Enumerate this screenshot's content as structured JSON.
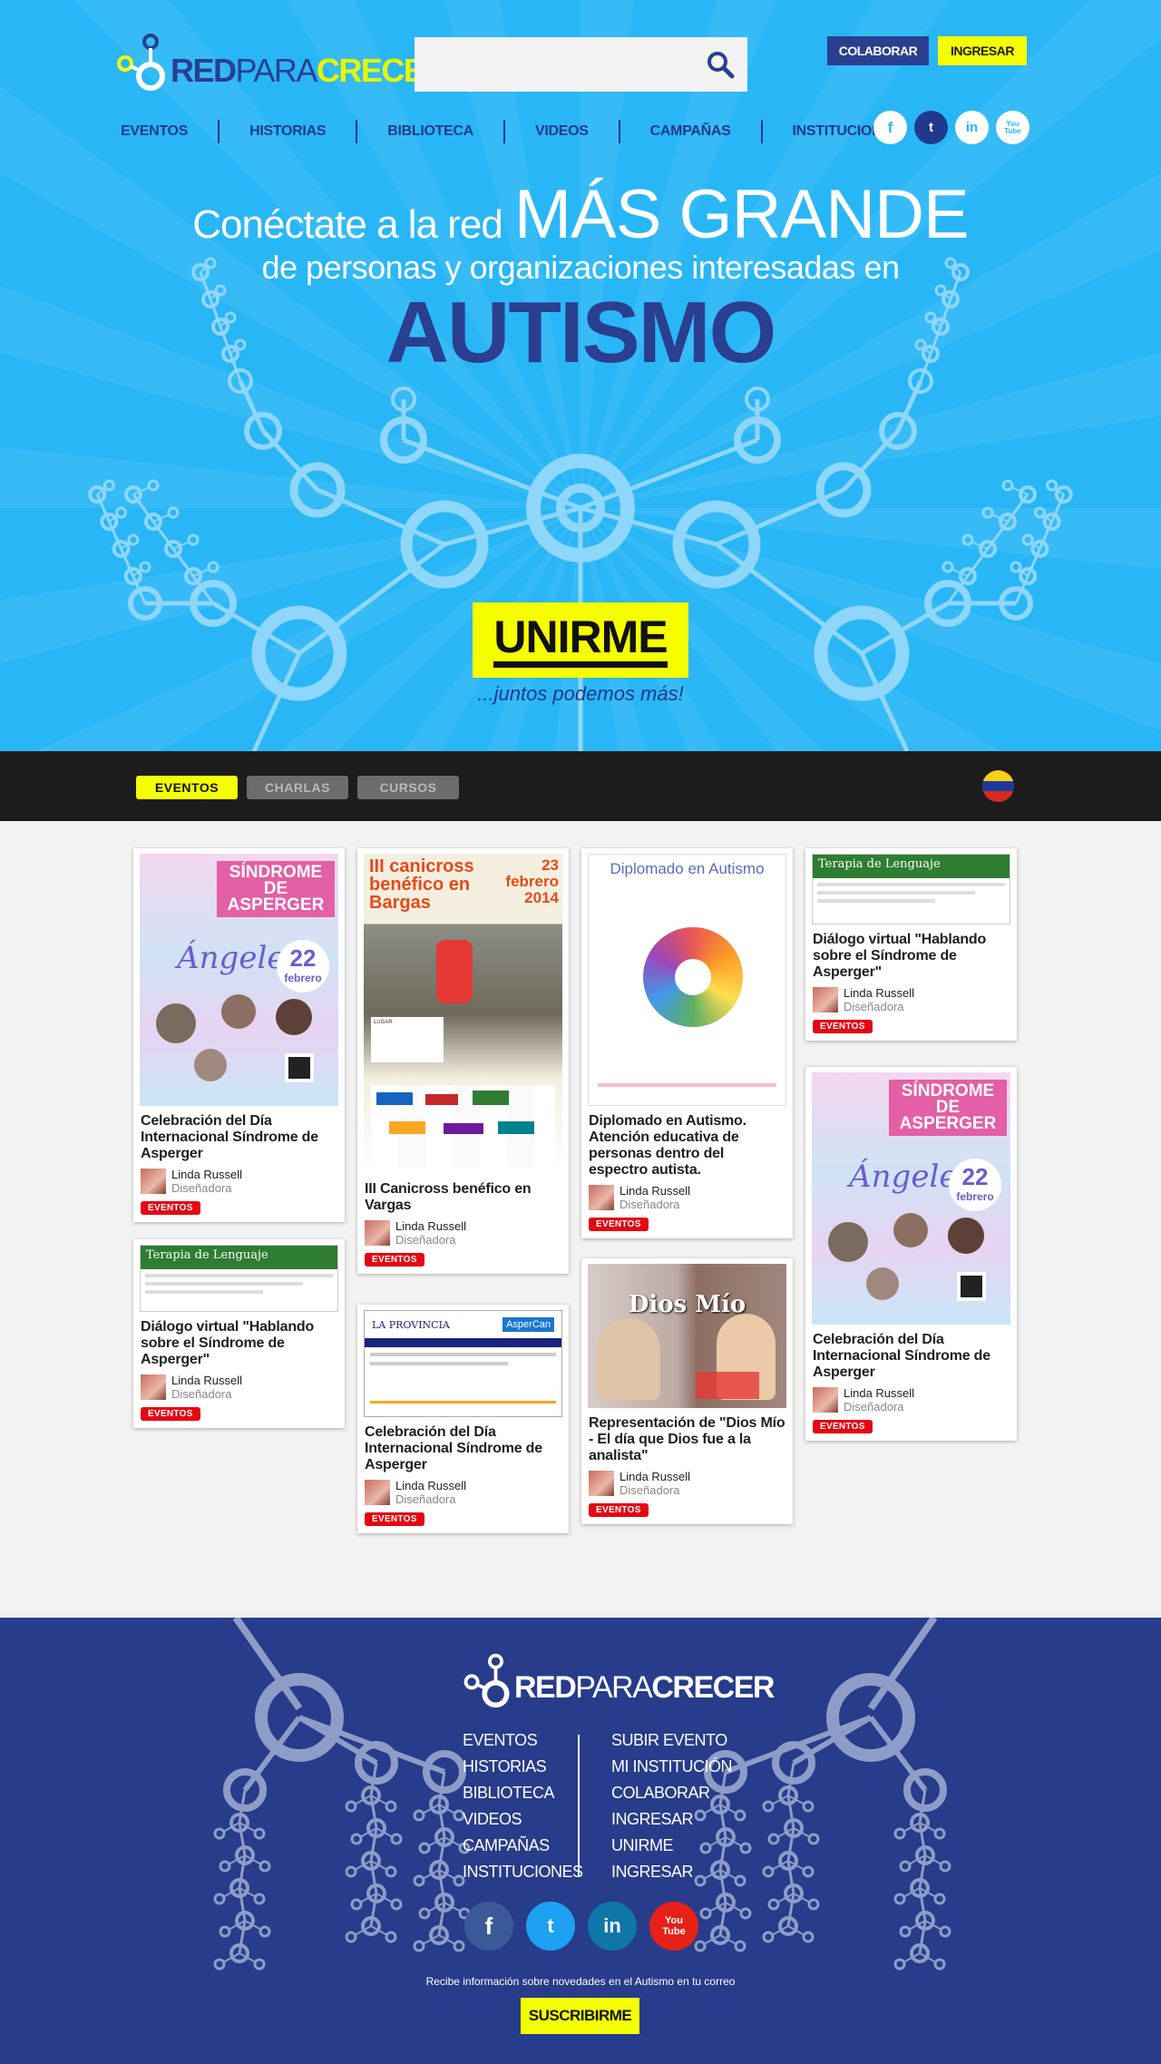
{
  "header": {
    "logo": {
      "part1": "RED",
      "part2": "PARA",
      "part3": "CRECER"
    },
    "search": {
      "placeholder": "",
      "icon": "search-icon"
    },
    "buttons": {
      "colaborar": "COLABORAR",
      "ingresar": "INGRESAR"
    },
    "nav": [
      "EVENTOS",
      "HISTORIAS",
      "BIBLIOTECA",
      "VIDEOS",
      "CAMPAÑAS",
      "INSTITUCIONES"
    ],
    "social": [
      {
        "name": "facebook-icon",
        "glyph": "f"
      },
      {
        "name": "twitter-icon",
        "glyph": "t"
      },
      {
        "name": "linkedin-icon",
        "glyph": "in"
      },
      {
        "name": "youtube-icon",
        "glyph": "You Tube"
      }
    ]
  },
  "hero": {
    "line1_a": "Conéctate a la red",
    "line1_b": "MÁS GRANDE",
    "line2": "de personas y organizaciones interesadas en",
    "line3": "AUTISMO",
    "cta": "UNIRME",
    "tagline": "...juntos podemos más!"
  },
  "filters": {
    "tabs": [
      "EVENTOS",
      "CHARLAS",
      "CURSOS"
    ],
    "active": "EVENTOS",
    "country_flag": "venezuela-flag"
  },
  "cards": [
    {
      "title": "Celebración del Día Internacional Síndrome de Asperger",
      "author": "Linda Russell",
      "role": "Diseñadora",
      "tag": "EVENTOS",
      "thumb": {
        "type": "asperger",
        "header": "SÍNDROME DE ASPERGER",
        "script": "Ángeles",
        "date_num": "22",
        "date_month": "febrero"
      }
    },
    {
      "title": "Diálogo virtual \"Hablando sobre el Síndrome de Asperger\"",
      "author": "Linda Russell",
      "role": "Diseñadora",
      "tag": "EVENTOS",
      "thumb": {
        "type": "terapia",
        "header": "Terapia de Lenguaje"
      }
    },
    {
      "title": "III Canicross benéfico en Vargas",
      "author": "Linda Russell",
      "role": "Diseñadora",
      "tag": "EVENTOS",
      "thumb": {
        "type": "canicross",
        "header": "III canicross benéfico en Bargas",
        "date": "23 febrero 2014"
      }
    },
    {
      "title": "Celebración del Día Internacional Síndrome de Asperger",
      "author": "Linda Russell",
      "role": "Diseñadora",
      "tag": "EVENTOS",
      "thumb": {
        "type": "newspaper",
        "header": "LA PROVINCIA",
        "sub": "AsperCan"
      }
    },
    {
      "title": "Diplomado en Autismo. Atención educativa de personas dentro del espectro autista.",
      "author": "Linda Russell",
      "role": "Diseñadora",
      "tag": "EVENTOS",
      "thumb": {
        "type": "diplomado",
        "header": "Diplomado en Autismo"
      }
    },
    {
      "title": "Representación de \"Dios Mío - El día que Dios fue a la analista\"",
      "author": "Linda Russell",
      "role": "Diseñadora",
      "tag": "EVENTOS",
      "thumb": {
        "type": "theater",
        "header": "Dios Mío"
      }
    },
    {
      "title": "Diálogo virtual \"Hablando sobre el Síndrome de Asperger\"",
      "author": "Linda Russell",
      "role": "Diseñadora",
      "tag": "EVENTOS",
      "thumb": {
        "type": "terapia",
        "header": "Terapia de Lenguaje"
      }
    },
    {
      "title": "Celebración del Día Internacional Síndrome de Asperger",
      "author": "Linda Russell",
      "role": "Diseñadora",
      "tag": "EVENTOS",
      "thumb": {
        "type": "asperger",
        "header": "SÍNDROME DE ASPERGER",
        "script": "Ángeles",
        "date_num": "22",
        "date_month": "febrero"
      }
    }
  ],
  "footer": {
    "col1": [
      "EVENTOS",
      "HISTORIAS",
      "BIBLIOTECA",
      "VIDEOS",
      "CAMPAÑAS",
      "INSTITUCIONES"
    ],
    "col2": [
      "SUBIR EVENTO",
      "MI INSTITUCIÓN",
      "COLABORAR",
      "INGRESAR",
      "UNIRME",
      "INGRESAR"
    ],
    "social": [
      {
        "name": "facebook-icon",
        "glyph": "f",
        "color": "#3b5998"
      },
      {
        "name": "twitter-icon",
        "glyph": "t",
        "color": "#1da1f2"
      },
      {
        "name": "linkedin-icon",
        "glyph": "in",
        "color": "#0e76a8"
      },
      {
        "name": "youtube-icon",
        "glyph": "You Tube",
        "color": "#e62117"
      }
    ],
    "newsletter": "Recibe información sobre novedades en el Autismo en tu correo",
    "subscribe": "SUSCRIBIRME"
  },
  "colors": {
    "hero_bg": "#29b6f6",
    "navy": "#273c8a",
    "yellow": "#f5ff00",
    "tag_red": "#e30613"
  }
}
